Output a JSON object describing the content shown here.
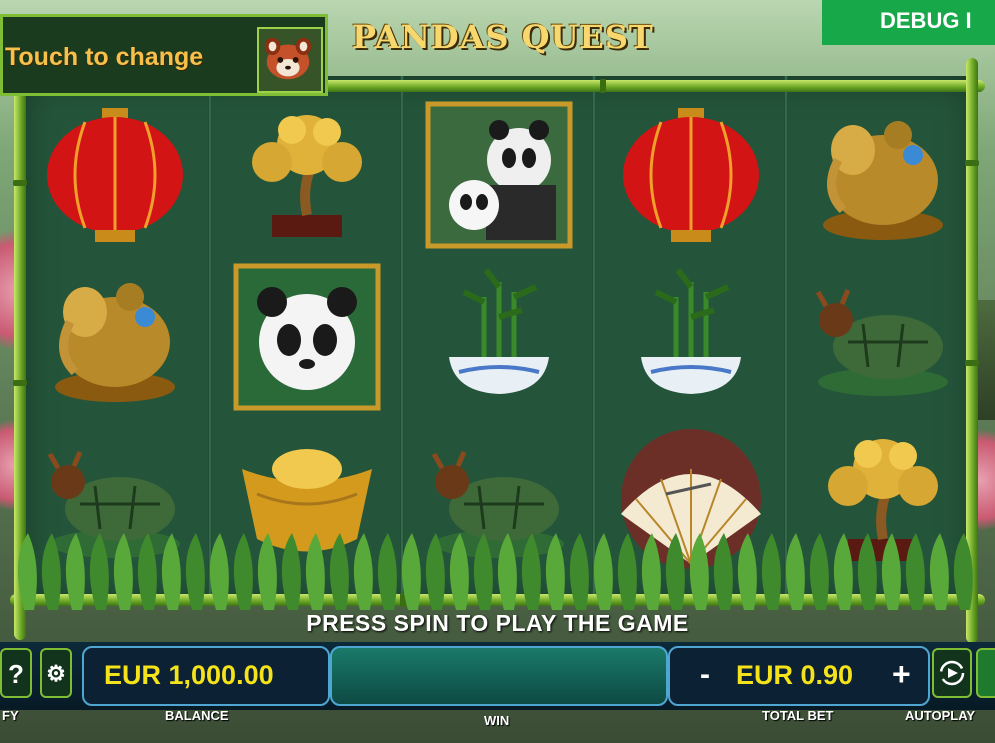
{
  "header": {
    "change_label": "Touch to change",
    "game_title": "PANDAS QUEST",
    "debug_label": "DEBUG I"
  },
  "reels": [
    [
      "red-lantern",
      "golden-elephant",
      "jade-turtle"
    ],
    [
      "money-tree",
      "panda-cub",
      "gold-ingot"
    ],
    [
      "panda-family",
      "lucky-bamboo",
      "jade-turtle"
    ],
    [
      "red-lantern",
      "lucky-bamboo",
      "folding-fan"
    ],
    [
      "golden-elephant",
      "jade-turtle",
      "money-tree"
    ]
  ],
  "status_message": "PRESS SPIN TO PLAY THE GAME",
  "controls": {
    "help_icon": "?",
    "balance_value": "EUR 1,000.00",
    "balance_label": "BALANCE",
    "win_label": "WIN",
    "bet_minus": "-",
    "bet_value": "EUR 0.90",
    "bet_plus": "+",
    "total_bet_label": "TOTAL BET",
    "autoplay_label": "AUTOPLAY",
    "paytable_label_partial": "FY"
  },
  "colors": {
    "accent_bamboo": "#6aa524",
    "value_yellow": "#f4e21a",
    "frame_green": "#24553a",
    "debug_green": "#17a84a"
  }
}
